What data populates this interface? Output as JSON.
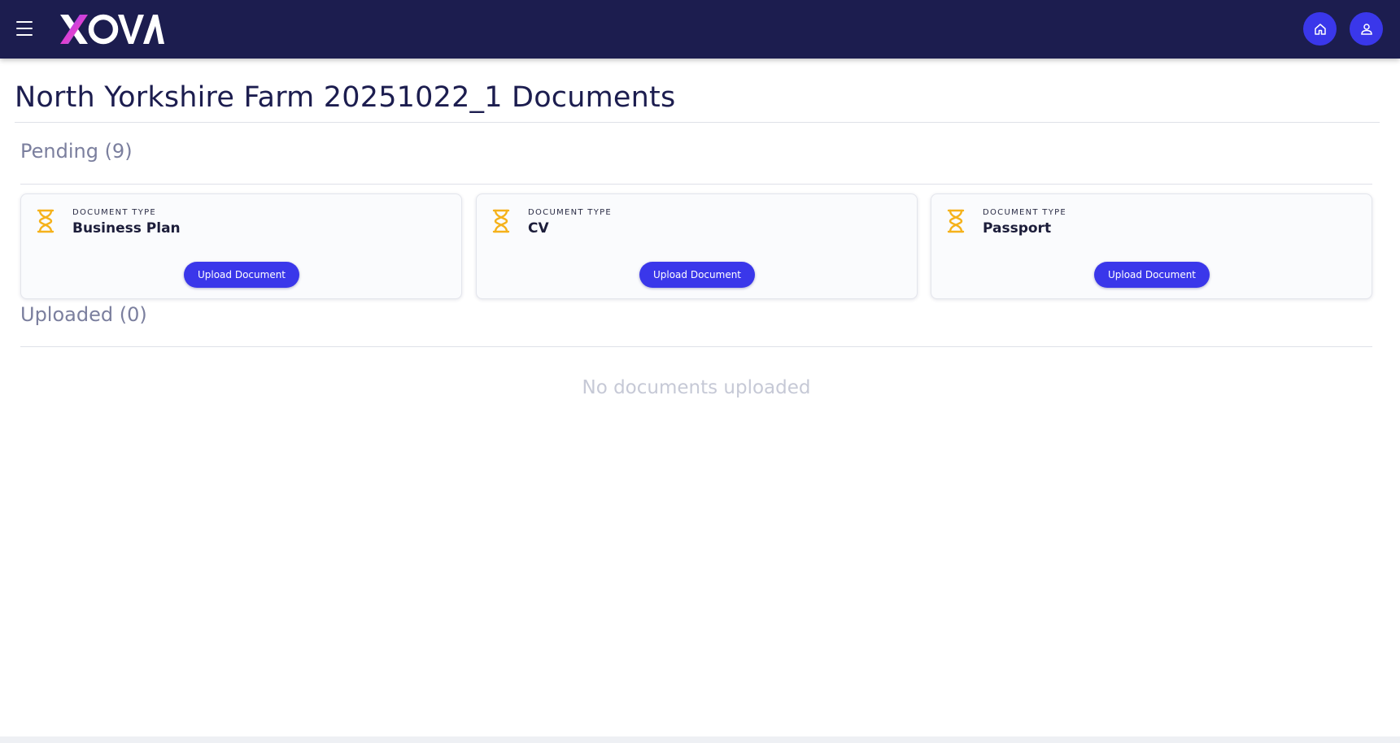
{
  "header": {
    "menu_icon": "hamburger-menu-icon",
    "logo_text": "XOVA",
    "home_icon": "home-icon",
    "user_icon": "user-icon"
  },
  "page": {
    "title": "North Yorkshire Farm 20251022_1 Documents"
  },
  "pending": {
    "heading": "Pending (9)",
    "cards": [
      {
        "label": "DOCUMENT TYPE",
        "name": "Business Plan",
        "button": "Upload Document",
        "icon": "hourglass-icon"
      },
      {
        "label": "DOCUMENT TYPE",
        "name": "CV",
        "button": "Upload Document",
        "icon": "hourglass-icon"
      },
      {
        "label": "DOCUMENT TYPE",
        "name": "Passport",
        "button": "Upload Document",
        "icon": "hourglass-icon"
      }
    ]
  },
  "uploaded": {
    "heading": "Uploaded (0)",
    "empty_message": "No documents uploaded"
  },
  "colors": {
    "header_bg": "#1c1d4f",
    "accent": "#3a37ea",
    "pending_icon": "#f5b21b",
    "section_heading": "#7b7f9e"
  }
}
